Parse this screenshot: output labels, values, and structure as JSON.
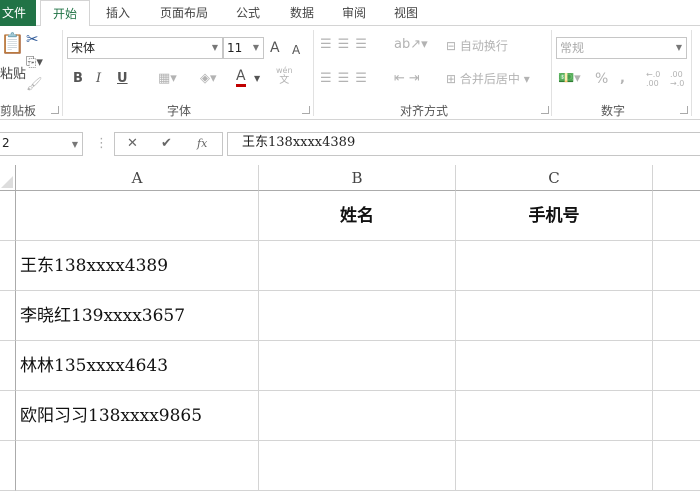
{
  "tabs": [
    "文件",
    "开始",
    "插入",
    "页面布局",
    "公式",
    "数据",
    "审阅",
    "视图"
  ],
  "ribbon": {
    "clipboard": {
      "paste": "粘贴",
      "label": "剪贴板"
    },
    "font": {
      "name": "宋体",
      "size": "11",
      "label": "字体",
      "bold": "B",
      "italic": "I",
      "underline": "U",
      "grow": "A",
      "shrink": "A",
      "font_color": "A",
      "phonetic": "wén",
      "phonetic_sub": "文",
      "font_color_hex": "#c00000"
    },
    "alignment": {
      "wrap": "自动换行",
      "merge": "合并后居中",
      "label": "对齐方式"
    },
    "number": {
      "format": "常规",
      "percent": "%",
      "comma": ",",
      "label": "数字"
    }
  },
  "formula_bar": {
    "name_box": "2",
    "cancel": "✕",
    "enter": "✔",
    "fx": "fx",
    "value": "王东138xxxx4389"
  },
  "columns": [
    "A",
    "B",
    "C"
  ],
  "rows": [
    [
      "",
      "姓名",
      "手机号"
    ],
    [
      "王东138xxxx4389",
      "",
      ""
    ],
    [
      "李晓红139xxxx3657",
      "",
      ""
    ],
    [
      "林林135xxxx4643",
      "",
      ""
    ],
    [
      "欧阳习习138xxxx9865",
      "",
      ""
    ],
    [
      "",
      "",
      ""
    ]
  ]
}
